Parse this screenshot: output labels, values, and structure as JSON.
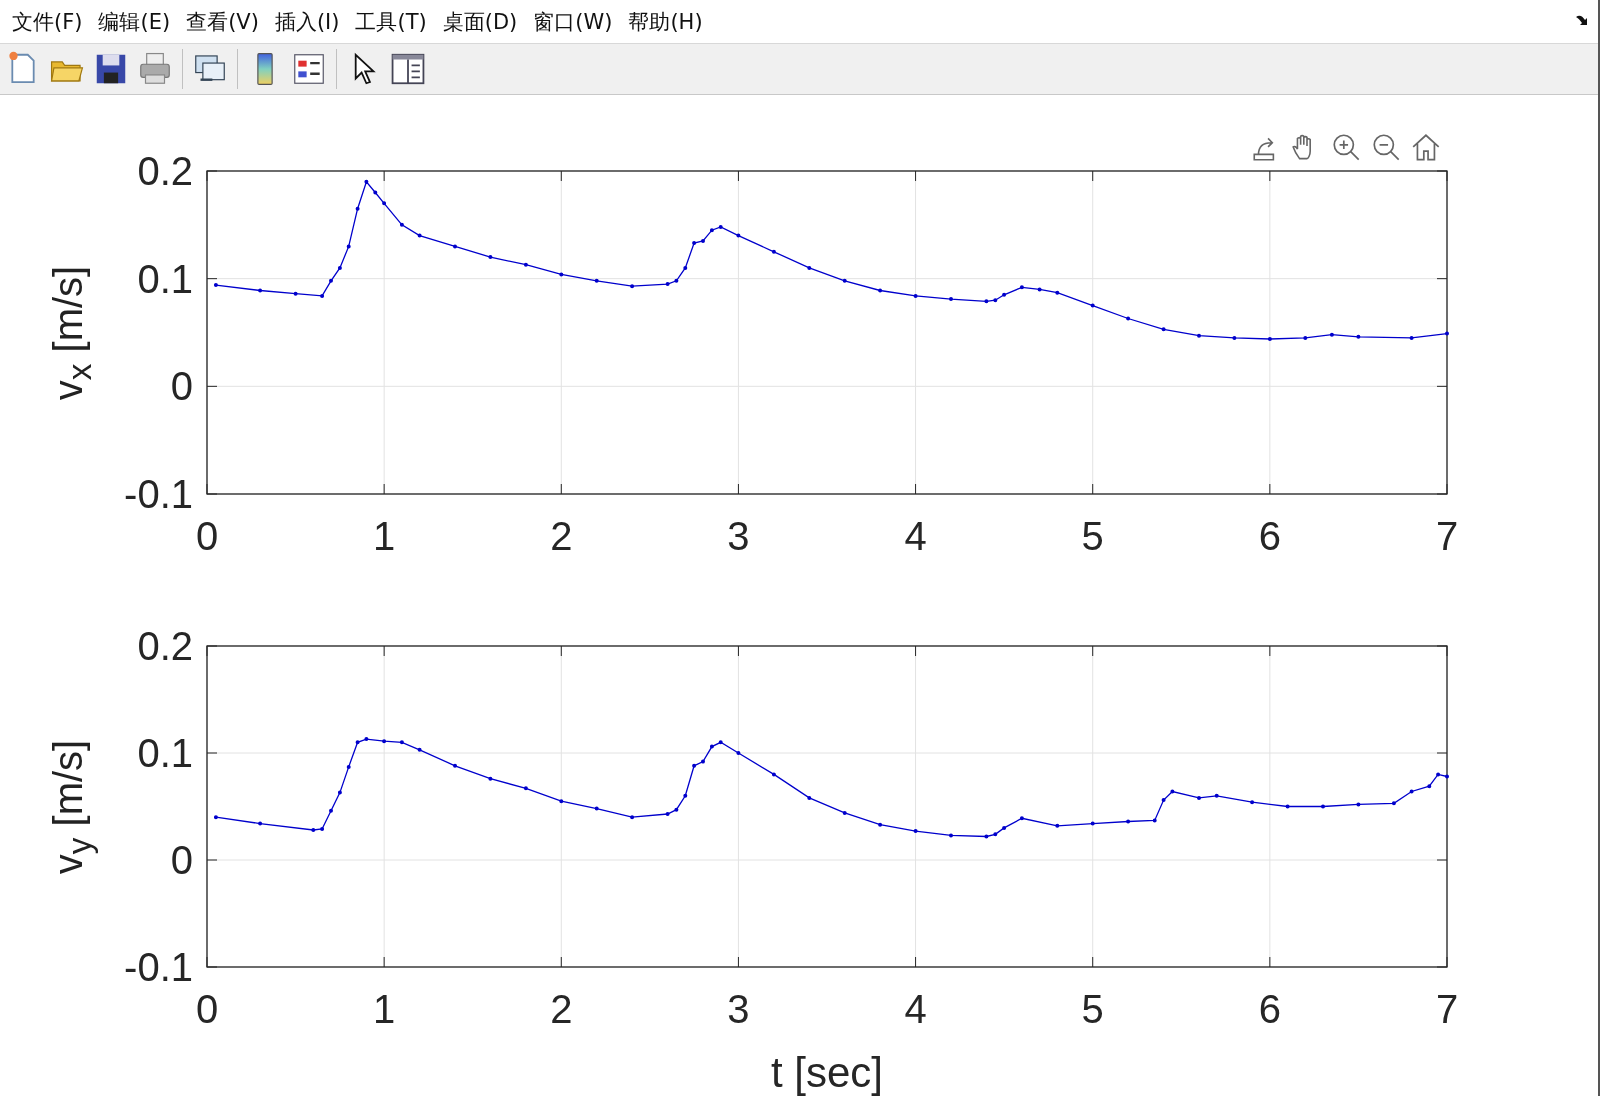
{
  "menu": [
    "文件(F)",
    "编辑(E)",
    "查看(V)",
    "插入(I)",
    "工具(T)",
    "桌面(D)",
    "窗口(W)",
    "帮助(H)"
  ],
  "toolbar": [
    {
      "kind": "new"
    },
    {
      "kind": "open"
    },
    {
      "kind": "save"
    },
    {
      "kind": "print"
    },
    {
      "kind": "separator"
    },
    {
      "kind": "link"
    },
    {
      "kind": "separator"
    },
    {
      "kind": "colorbar"
    },
    {
      "kind": "legend"
    },
    {
      "kind": "separator"
    },
    {
      "kind": "pointer"
    },
    {
      "kind": "panel"
    }
  ],
  "axes_toolbar": [
    {
      "kind": "brush"
    },
    {
      "kind": "pan"
    },
    {
      "kind": "zoom_in"
    },
    {
      "kind": "zoom_out"
    },
    {
      "kind": "home"
    }
  ],
  "plots": [
    {
      "ylabel": "v$_{x}$ [m/s]",
      "chart_data": {
        "type": "line",
        "grid": true,
        "xlim": [
          0,
          7
        ],
        "ylim": [
          -0.1,
          0.2
        ],
        "xticks": [
          0,
          1,
          2,
          3,
          4,
          5,
          6,
          7
        ],
        "yticks": [
          -0.1,
          0,
          0.1,
          0.2
        ],
        "x": [
          0.05,
          0.3,
          0.5,
          0.65,
          0.7,
          0.75,
          0.8,
          0.85,
          0.9,
          0.95,
          1.0,
          1.1,
          1.2,
          1.4,
          1.6,
          1.8,
          2.0,
          2.2,
          2.4,
          2.6,
          2.65,
          2.7,
          2.75,
          2.8,
          2.85,
          2.9,
          3.0,
          3.2,
          3.4,
          3.6,
          3.8,
          4.0,
          4.2,
          4.4,
          4.45,
          4.5,
          4.6,
          4.7,
          4.8,
          5.0,
          5.2,
          5.4,
          5.6,
          5.8,
          6.0,
          6.2,
          6.35,
          6.5,
          6.8,
          7.0
        ],
        "series": [
          {
            "color": "#0000cc",
            "values": [
              0.094,
              0.089,
              0.086,
              0.084,
              0.098,
              0.11,
              0.13,
              0.165,
              0.19,
              0.18,
              0.17,
              0.15,
              0.14,
              0.13,
              0.12,
              0.113,
              0.104,
              0.098,
              0.093,
              0.095,
              0.098,
              0.11,
              0.133,
              0.135,
              0.145,
              0.148,
              0.14,
              0.125,
              0.11,
              0.098,
              0.089,
              0.084,
              0.081,
              0.079,
              0.08,
              0.085,
              0.092,
              0.09,
              0.087,
              0.075,
              0.063,
              0.053,
              0.047,
              0.045,
              0.044,
              0.045,
              0.048,
              0.046,
              0.045,
              0.049
            ]
          }
        ]
      }
    },
    {
      "ylabel": "v$_{y}$ [m/s]",
      "chart_data": {
        "type": "line",
        "grid": true,
        "xlabel": "t [sec]",
        "xlim": [
          0,
          7
        ],
        "ylim": [
          -0.1,
          0.2
        ],
        "xticks": [
          0,
          1,
          2,
          3,
          4,
          5,
          6,
          7
        ],
        "yticks": [
          -0.1,
          0,
          0.1,
          0.2
        ],
        "x": [
          0.05,
          0.3,
          0.6,
          0.65,
          0.7,
          0.75,
          0.8,
          0.85,
          0.9,
          1.0,
          1.1,
          1.2,
          1.4,
          1.6,
          1.8,
          2.0,
          2.2,
          2.4,
          2.6,
          2.65,
          2.7,
          2.75,
          2.8,
          2.85,
          2.9,
          3.0,
          3.2,
          3.4,
          3.6,
          3.8,
          4.0,
          4.2,
          4.4,
          4.45,
          4.5,
          4.6,
          4.8,
          5.0,
          5.2,
          5.35,
          5.4,
          5.45,
          5.6,
          5.7,
          5.9,
          6.1,
          6.3,
          6.5,
          6.7,
          6.8,
          6.9,
          6.95,
          7.0
        ],
        "series": [
          {
            "color": "#0000cc",
            "values": [
              0.04,
              0.034,
              0.028,
              0.029,
              0.046,
              0.063,
              0.087,
              0.11,
              0.113,
              0.111,
              0.11,
              0.103,
              0.088,
              0.076,
              0.067,
              0.055,
              0.048,
              0.04,
              0.043,
              0.047,
              0.06,
              0.088,
              0.092,
              0.106,
              0.11,
              0.1,
              0.08,
              0.058,
              0.044,
              0.033,
              0.027,
              0.023,
              0.022,
              0.024,
              0.03,
              0.039,
              0.032,
              0.034,
              0.036,
              0.037,
              0.056,
              0.064,
              0.058,
              0.06,
              0.054,
              0.05,
              0.05,
              0.052,
              0.053,
              0.064,
              0.069,
              0.08,
              0.078
            ]
          }
        ]
      }
    }
  ]
}
